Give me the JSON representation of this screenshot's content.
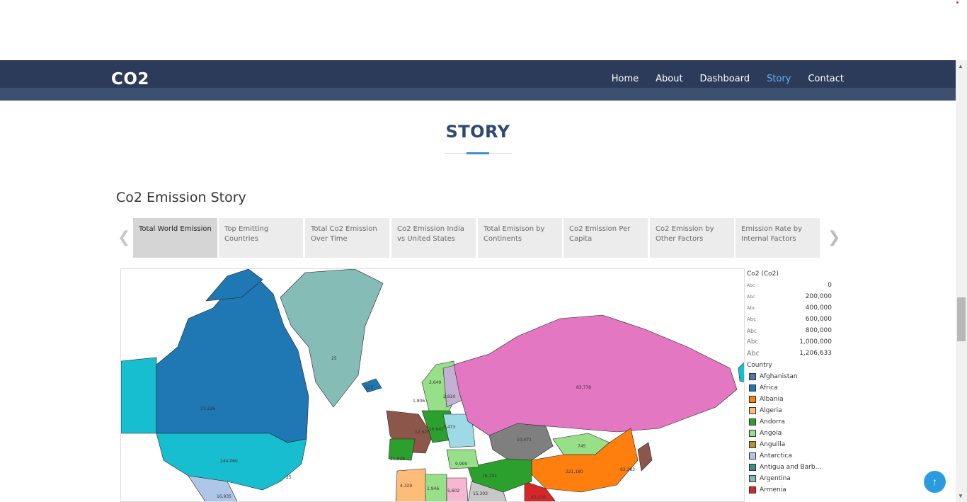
{
  "brand": {
    "logo": "CO2"
  },
  "nav": {
    "items": [
      {
        "label": "Home",
        "active": false
      },
      {
        "label": "About",
        "active": false
      },
      {
        "label": "Dashboard",
        "active": false
      },
      {
        "label": "Story",
        "active": true
      },
      {
        "label": "Contact",
        "active": false
      }
    ],
    "active_color": "#5ab4ec"
  },
  "section": {
    "title": "STORY"
  },
  "story": {
    "heading": "Co2 Emission Story",
    "tabs": [
      {
        "label": "Total World Emission",
        "active": true
      },
      {
        "label": "Top Emitting Countries",
        "active": false
      },
      {
        "label": "Total Co2 Emission Over Time",
        "active": false
      },
      {
        "label": "Co2 Emission India vs United States",
        "active": false
      },
      {
        "label": "Total Emisison by Continents",
        "active": false
      },
      {
        "label": "Co2 Emission Per Capita",
        "active": false
      },
      {
        "label": "Co2 Emission by Other Factors",
        "active": false
      },
      {
        "label": "Emission Rate by Internal Factors",
        "active": false
      }
    ],
    "prev_icon": "chevron-left-icon",
    "next_icon": "chevron-right-icon"
  },
  "map": {
    "labels": {
      "canada": "23,226",
      "greenland": "25",
      "iceland": "122",
      "usa": "244,060",
      "us_small": "25",
      "mexico": "16,935",
      "russia": "83,778",
      "kazakhstan": "10,471",
      "mongolia": "745",
      "china": "221,180",
      "india": "42,216",
      "iran": "15,303",
      "algeria": "4,329",
      "libya": "1,946",
      "egypt": "5,602",
      "turkey": "9,999",
      "saudi": "16,702",
      "sweden": "2,649",
      "finland": "2,810",
      "norway": "1,806",
      "poland": "12,620",
      "ukraine": "16,642",
      "belarus": "3,473",
      "spain": "21,838",
      "japan": "63,383"
    }
  },
  "legend": {
    "size_title": "Co2 (Co2)",
    "size_marker": "Abc",
    "size_values": [
      "0",
      "200,000",
      "400,000",
      "600,000",
      "800,000",
      "1,000,000",
      "1,206,633"
    ],
    "country_title": "Country",
    "countries": [
      {
        "name": "Afghanistan",
        "color": "#4e79a7"
      },
      {
        "name": "Africa",
        "color": "#1f77b4"
      },
      {
        "name": "Albania",
        "color": "#ff7f0e"
      },
      {
        "name": "Algeria",
        "color": "#ffbb78"
      },
      {
        "name": "Andorra",
        "color": "#2ca02c"
      },
      {
        "name": "Angola",
        "color": "#98df8a"
      },
      {
        "name": "Anguilla",
        "color": "#b5942d"
      },
      {
        "name": "Antarctica",
        "color": "#aec7e8"
      },
      {
        "name": "Antigua and Barb...",
        "color": "#3a8f7f"
      },
      {
        "name": "Argentina",
        "color": "#86bcb6"
      },
      {
        "name": "Armenia",
        "color": "#d62728"
      }
    ]
  },
  "back_to_top": {
    "icon": "arrow-up-icon",
    "symbol": "↑"
  },
  "colors": {
    "navbar": "#2c3b59",
    "title": "#2e4a73",
    "accent": "#3d8fd6"
  }
}
